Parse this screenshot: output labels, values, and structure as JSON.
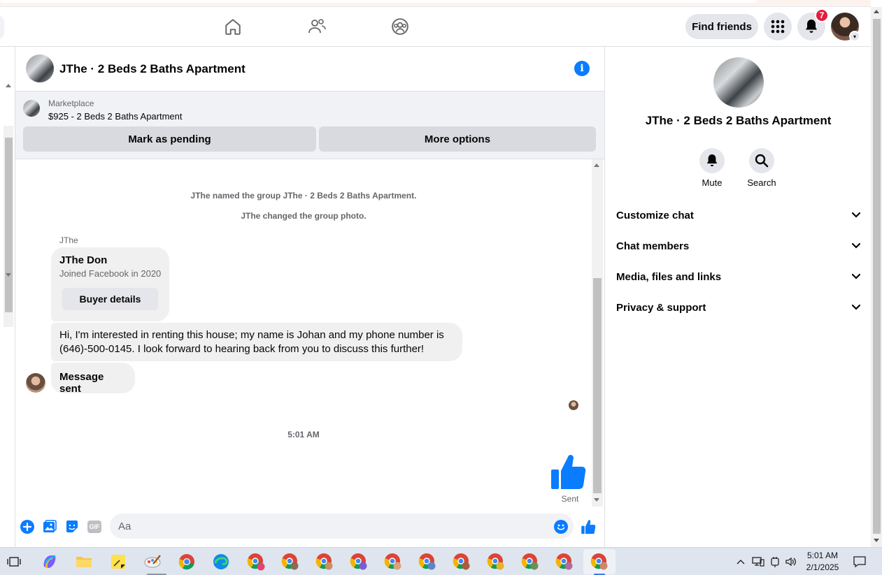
{
  "header": {
    "find_friends_label": "Find friends",
    "notification_count": "7"
  },
  "chat": {
    "title": "JThe · 2 Beds 2 Baths Apartment"
  },
  "listing": {
    "source_label": "Marketplace",
    "price_title": "$925 - 2 Beds 2 Baths Apartment",
    "mark_pending_label": "Mark as pending",
    "more_options_label": "More options"
  },
  "messages": {
    "system_1": "JThe named the group JThe · 2 Beds 2 Baths Apartment.",
    "system_2": "JThe changed the group photo.",
    "sender_name": "JThe",
    "profile_card": {
      "name": "JThe Don",
      "joined": "Joined Facebook in 2020",
      "button_label": "Buyer details"
    },
    "long_message": "Hi, I'm interested in renting this house; my name is Johan and my phone number is (646)-500-0145. I look forward to hearing back from you to discuss this further!",
    "short_message": "Message sent",
    "timestamp": "5:01 AM",
    "sent_status": "Sent"
  },
  "composer": {
    "placeholder": "Aa",
    "gif_label": "GIF"
  },
  "right_panel": {
    "title": "JThe · 2 Beds 2 Baths Apartment",
    "actions": [
      {
        "label": "Mute",
        "icon": "bell-icon"
      },
      {
        "label": "Search",
        "icon": "search-icon"
      }
    ],
    "sections": [
      {
        "label": "Customize chat"
      },
      {
        "label": "Chat members"
      },
      {
        "label": "Media, files and links"
      },
      {
        "label": "Privacy & support"
      }
    ]
  },
  "taskbar": {
    "time": "5:01 AM",
    "date": "2/1/2025"
  },
  "colors": {
    "accent": "#0a7cff",
    "badge": "#e41e3f",
    "bubble": "#f0f0f0",
    "button": "#e4e6eb"
  }
}
